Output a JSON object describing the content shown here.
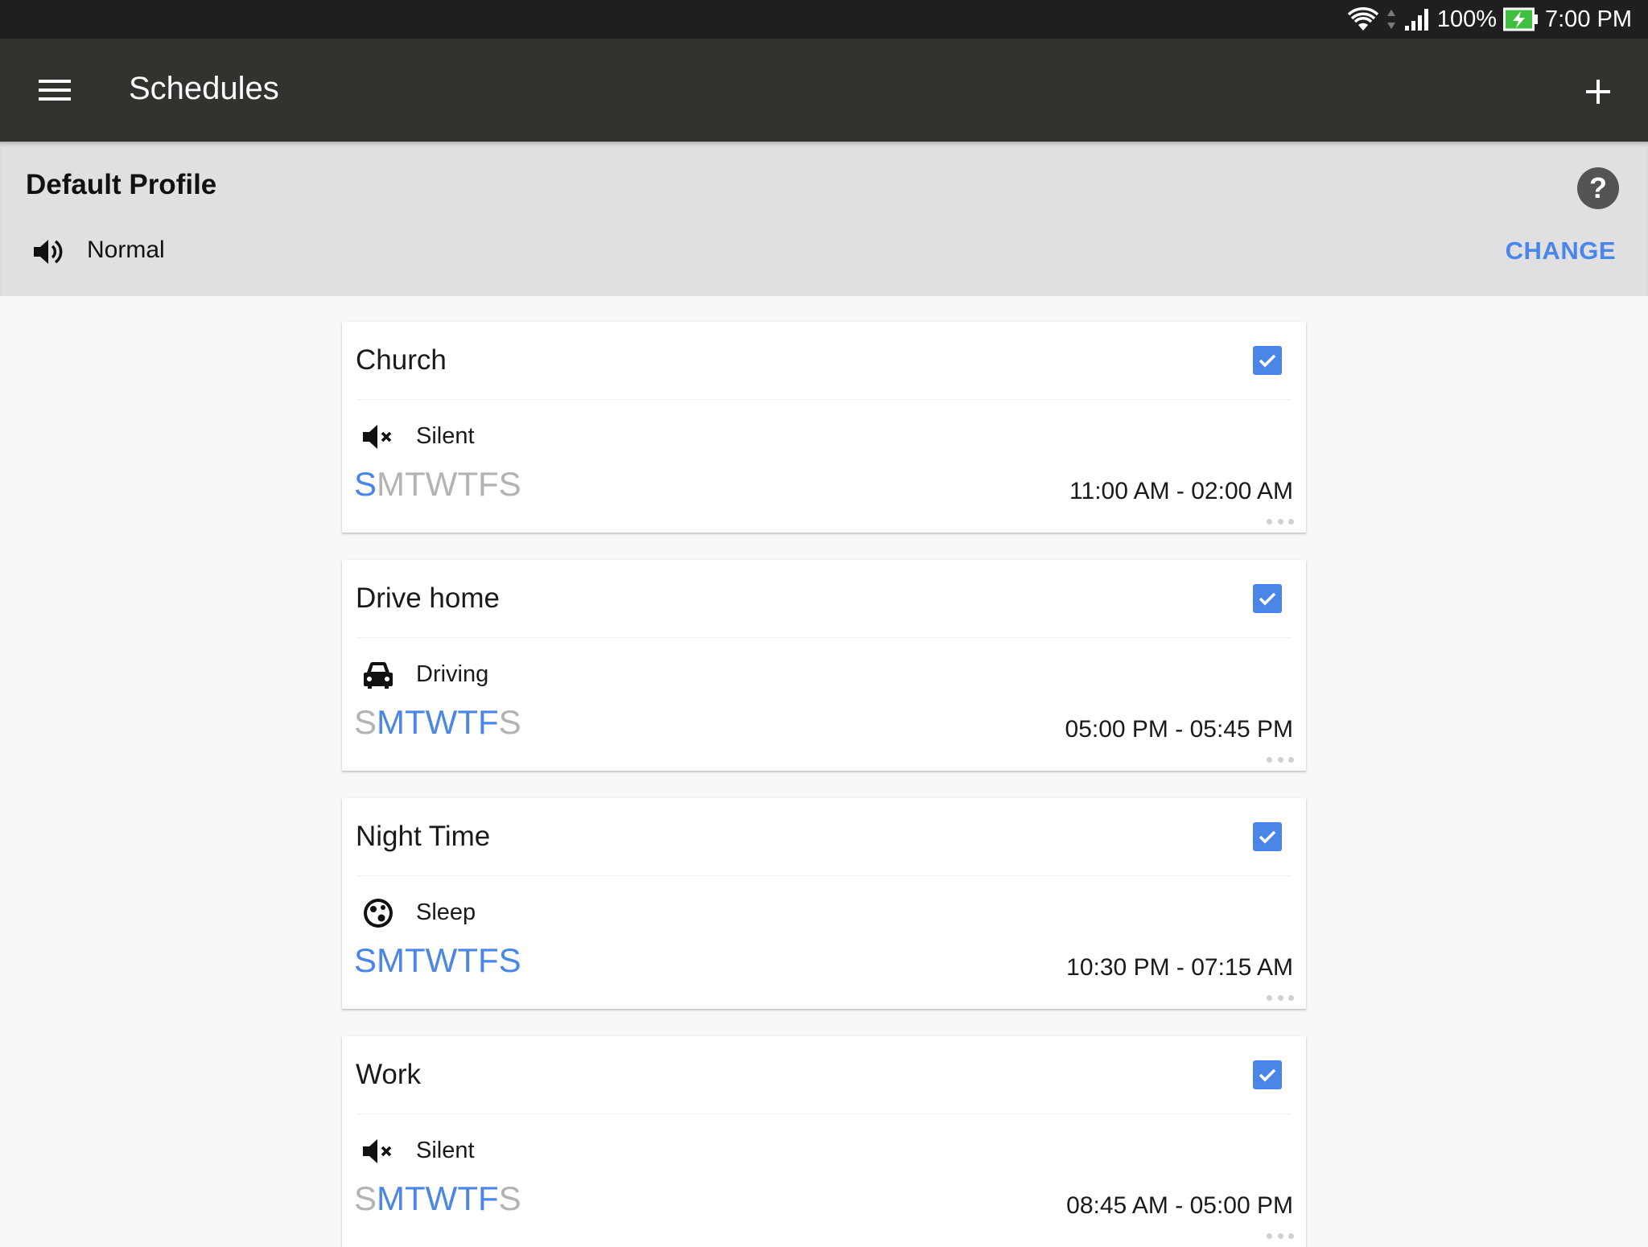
{
  "status_bar": {
    "battery": "100%",
    "time": "7:00 PM"
  },
  "app_bar": {
    "title": "Schedules",
    "menu_icon": "hamburger-menu-icon",
    "add_icon": "plus-icon"
  },
  "default_profile": {
    "title": "Default Profile",
    "mode": "Normal",
    "mode_icon": "volume-up-icon",
    "help_icon": "question-mark-icon",
    "change_label": "CHANGE"
  },
  "colors": {
    "accent": "#4a86e8",
    "day_off": "#b3b3b3",
    "app_bar": "#32322e",
    "status_bar": "#1f1f1f",
    "profile_bar": "#e0e0e2"
  },
  "schedules": [
    {
      "title": "Church",
      "enabled": true,
      "mode": "Silent",
      "mode_icon": "volume-off-icon",
      "days": [
        {
          "letter": "S",
          "active": true
        },
        {
          "letter": "M",
          "active": false
        },
        {
          "letter": "T",
          "active": false
        },
        {
          "letter": "W",
          "active": false
        },
        {
          "letter": "T",
          "active": false
        },
        {
          "letter": "F",
          "active": false
        },
        {
          "letter": "S",
          "active": false
        }
      ],
      "time": "11:00 AM - 02:00 AM"
    },
    {
      "title": "Drive home",
      "enabled": true,
      "mode": "Driving",
      "mode_icon": "car-icon",
      "days": [
        {
          "letter": "S",
          "active": false
        },
        {
          "letter": "M",
          "active": true
        },
        {
          "letter": "T",
          "active": true
        },
        {
          "letter": "W",
          "active": true
        },
        {
          "letter": "T",
          "active": true
        },
        {
          "letter": "F",
          "active": true
        },
        {
          "letter": "S",
          "active": false
        }
      ],
      "time": "05:00 PM - 05:45 PM"
    },
    {
      "title": "Night Time",
      "enabled": true,
      "mode": "Sleep",
      "mode_icon": "sleep-icon",
      "days": [
        {
          "letter": "S",
          "active": true
        },
        {
          "letter": "M",
          "active": true
        },
        {
          "letter": "T",
          "active": true
        },
        {
          "letter": "W",
          "active": true
        },
        {
          "letter": "T",
          "active": true
        },
        {
          "letter": "F",
          "active": true
        },
        {
          "letter": "S",
          "active": true
        }
      ],
      "time": "10:30 PM - 07:15 AM"
    },
    {
      "title": "Work",
      "enabled": true,
      "mode": "Silent",
      "mode_icon": "volume-off-icon",
      "days": [
        {
          "letter": "S",
          "active": false
        },
        {
          "letter": "M",
          "active": true
        },
        {
          "letter": "T",
          "active": true
        },
        {
          "letter": "W",
          "active": true
        },
        {
          "letter": "T",
          "active": true
        },
        {
          "letter": "F",
          "active": true
        },
        {
          "letter": "S",
          "active": false
        }
      ],
      "time": "08:45 AM - 05:00 PM"
    }
  ]
}
